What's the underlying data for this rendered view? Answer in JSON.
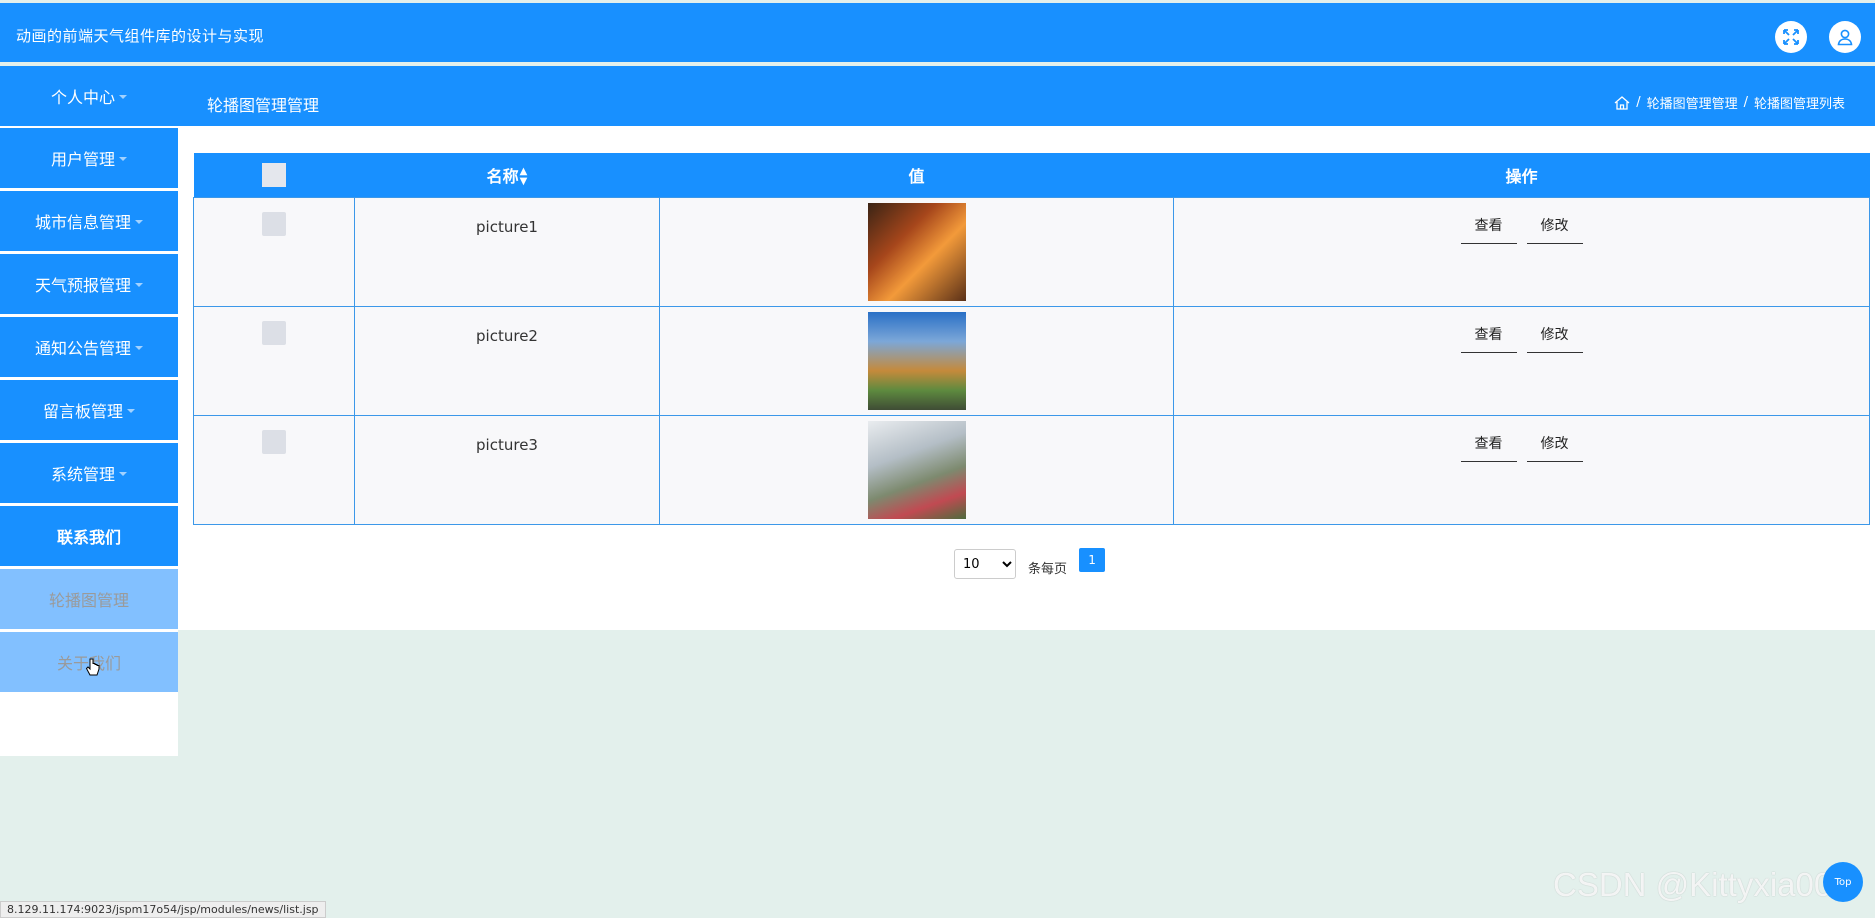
{
  "header": {
    "app_title": "动画的前端天气组件库的设计与实现",
    "fullscreen_icon": "expand-icon",
    "user_icon": "user-icon"
  },
  "subheader": {
    "section_title": "轮播图管理管理",
    "breadcrumb": {
      "home_icon": "home-icon",
      "sep": "/",
      "item1": "轮播图管理管理",
      "item2": "轮播图管理列表"
    }
  },
  "sidebar": {
    "items": [
      {
        "label": "个人中心"
      },
      {
        "label": "用户管理"
      },
      {
        "label": "城市信息管理"
      },
      {
        "label": "天气预报管理"
      },
      {
        "label": "通知公告管理"
      },
      {
        "label": "留言板管理"
      },
      {
        "label": "系统管理"
      },
      {
        "label": "联系我们"
      },
      {
        "label": "轮播图管理"
      },
      {
        "label": "关于我们"
      }
    ]
  },
  "table": {
    "headers": {
      "name": "名称",
      "value": "值",
      "actions": "操作"
    },
    "rows": [
      {
        "name": "picture1",
        "view": "查看",
        "edit": "修改"
      },
      {
        "name": "picture2",
        "view": "查看",
        "edit": "修改"
      },
      {
        "name": "picture3",
        "view": "查看",
        "edit": "修改"
      }
    ]
  },
  "pagination": {
    "page_size": "10",
    "page_size_options": [
      "10"
    ],
    "per_page_label": "条每页",
    "current_page": "1"
  },
  "status_bar": {
    "url": "8.129.11.174:9023/jspm17o54/jsp/modules/news/list.jsp"
  },
  "watermark": "CSDN @Kittyxia001",
  "floating_top": "Top",
  "colors": {
    "primary": "#1890ff",
    "sidebar_light": "#82c0ff",
    "page_background": "#e3f0ec"
  }
}
